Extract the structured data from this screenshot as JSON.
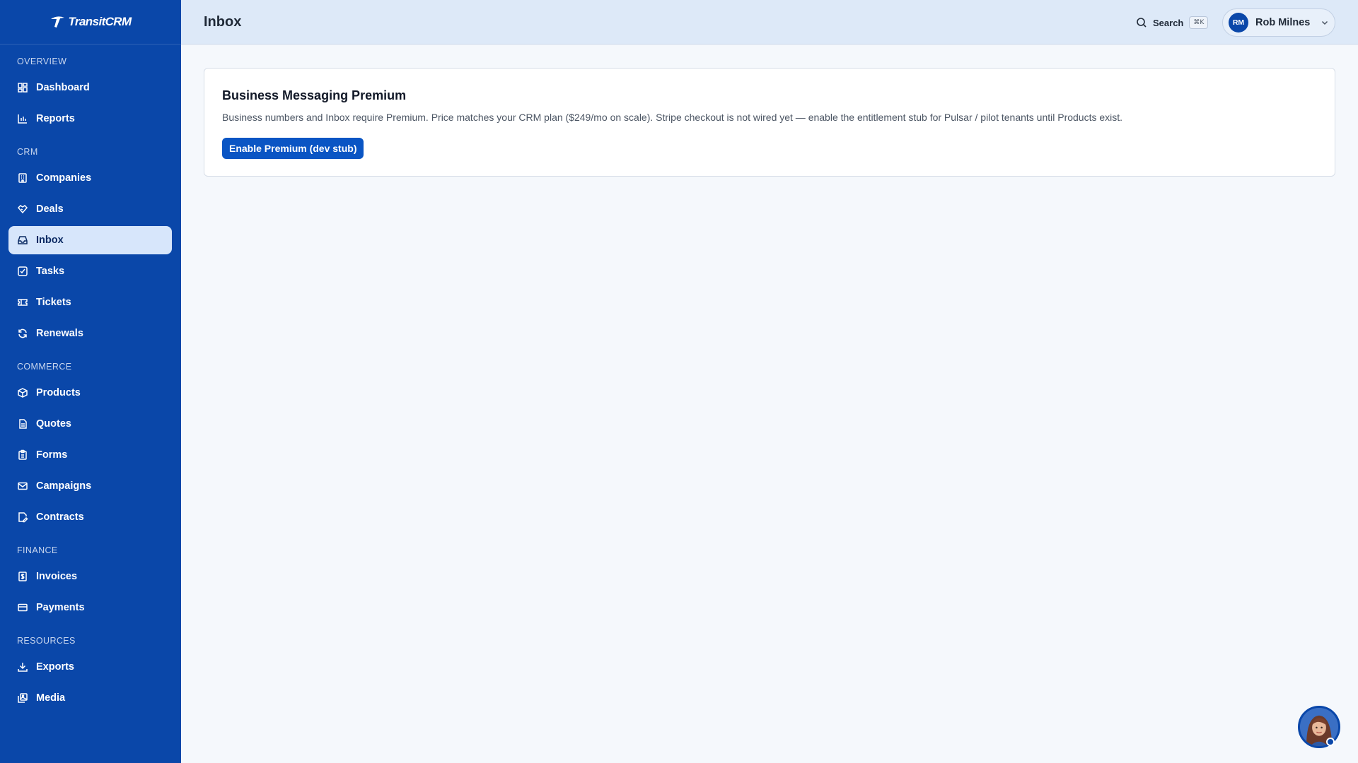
{
  "app": {
    "brand": "TransitCRM"
  },
  "sidebar": {
    "sections": [
      {
        "heading": "OVERVIEW",
        "items": [
          {
            "label": "Dashboard",
            "icon": "dashboard-grid-icon"
          },
          {
            "label": "Reports",
            "icon": "bar-chart-icon"
          }
        ]
      },
      {
        "heading": "CRM",
        "items": [
          {
            "label": "Companies",
            "icon": "building-icon"
          },
          {
            "label": "Deals",
            "icon": "handshake-icon"
          },
          {
            "label": "Inbox",
            "icon": "inbox-icon",
            "active": true
          },
          {
            "label": "Tasks",
            "icon": "checkbox-icon"
          },
          {
            "label": "Tickets",
            "icon": "ticket-icon"
          },
          {
            "label": "Renewals",
            "icon": "refresh-icon"
          }
        ]
      },
      {
        "heading": "COMMERCE",
        "items": [
          {
            "label": "Products",
            "icon": "package-icon"
          },
          {
            "label": "Quotes",
            "icon": "document-icon"
          },
          {
            "label": "Forms",
            "icon": "clipboard-icon"
          },
          {
            "label": "Campaigns",
            "icon": "mail-icon"
          },
          {
            "label": "Contracts",
            "icon": "file-edit-icon"
          }
        ]
      },
      {
        "heading": "FINANCE",
        "items": [
          {
            "label": "Invoices",
            "icon": "receipt-icon"
          },
          {
            "label": "Payments",
            "icon": "credit-card-icon"
          }
        ]
      },
      {
        "heading": "RESOURCES",
        "items": [
          {
            "label": "Exports",
            "icon": "download-icon"
          },
          {
            "label": "Media",
            "icon": "image-stack-icon"
          }
        ]
      }
    ]
  },
  "header": {
    "title": "Inbox",
    "search_label": "Search",
    "search_shortcut": "⌘K",
    "user": {
      "initials": "RM",
      "name": "Rob Milnes"
    }
  },
  "main": {
    "card": {
      "title": "Business Messaging Premium",
      "text": "Business numbers and Inbox require Premium. Price matches your CRM plan ($249/mo on scale). Stripe checkout is not wired yet — enable the entitlement stub for Pulsar / pilot tenants until Products exist.",
      "button_label": "Enable Premium (dev stub)"
    }
  },
  "colors": {
    "sidebar": "#0a47a9",
    "accent": "#0a55c4",
    "active_item": "#d7e6fb",
    "topbar": "#dde9f8"
  }
}
